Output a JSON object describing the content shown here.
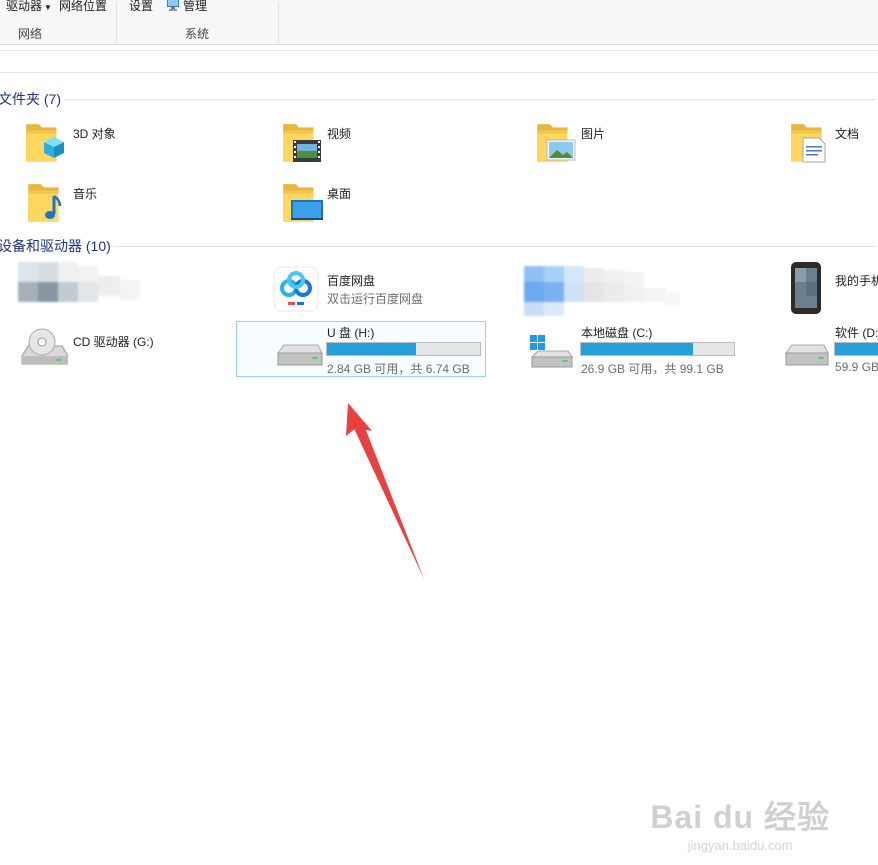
{
  "ribbon": {
    "drive_btn": "驱动器",
    "network_location_btn": "网络位置",
    "network_group": "网络",
    "settings_btn": "设置",
    "manage_btn": "管理",
    "system_group": "系统"
  },
  "sections": {
    "folders": "文件夹 (7)",
    "devices": "设备和驱动器 (10)"
  },
  "folders": [
    {
      "name": "3D 对象",
      "icon": "3d-objects-folder-icon"
    },
    {
      "name": "视频",
      "icon": "videos-folder-icon"
    },
    {
      "name": "图片",
      "icon": "pictures-folder-icon"
    },
    {
      "name": "文档",
      "icon": "documents-folder-icon"
    },
    {
      "name": "音乐",
      "icon": "music-folder-icon"
    },
    {
      "name": "桌面",
      "icon": "desktop-folder-icon"
    }
  ],
  "devices": {
    "baidu": {
      "name": "百度网盘",
      "sub": "双击运行百度网盘"
    },
    "phone": {
      "name": "我的手机"
    },
    "cd": {
      "name": "CD 驱动器 (G:)"
    },
    "usb": {
      "name": "U 盘 (H:)",
      "space": "2.84 GB 可用，共 6.74 GB",
      "used_fraction": 0.58
    },
    "local_c": {
      "name": "本地磁盘 (C:)",
      "space": "26.9 GB 可用，共 99.1 GB",
      "used_fraction": 0.73
    },
    "soft_d": {
      "name": "软件 (D:",
      "space": "59.9 GB"
    }
  },
  "colors": {
    "section_header": "#1e3287",
    "drive_fill": "#26a0da",
    "arrow": "#e8413f"
  },
  "watermark": {
    "brand": "Bai du 经验",
    "url": "jingyan.baidu.com"
  }
}
